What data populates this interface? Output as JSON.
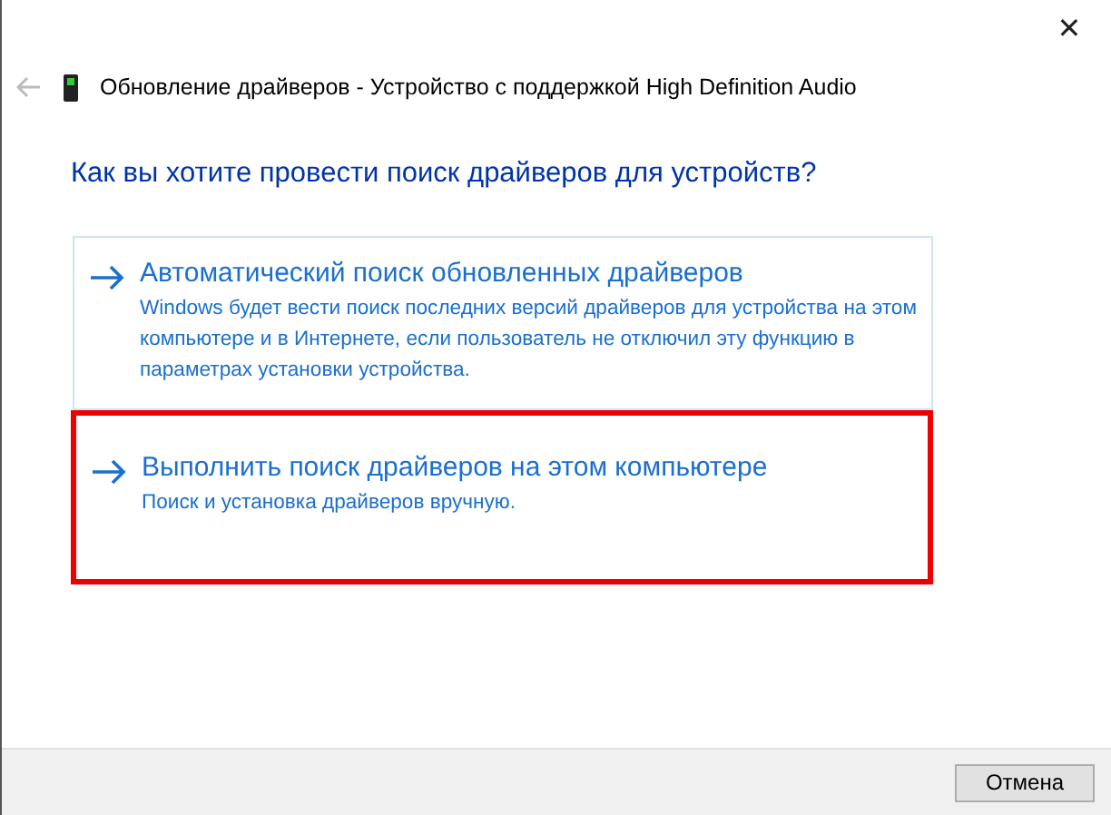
{
  "window": {
    "title": "Обновление драйверов - Устройство с поддержкой High Definition Audio",
    "close": "✕"
  },
  "heading": "Как вы хотите провести поиск драйверов для устройств?",
  "options": [
    {
      "title": "Автоматический поиск обновленных драйверов",
      "description": "Windows будет вести поиск последних версий драйверов для устройства на этом компьютере и в Интернете, если пользователь не отключил эту функцию в параметрах установки устройства.",
      "hovered": true,
      "highlighted": false
    },
    {
      "title": "Выполнить поиск драйверов на этом компьютере",
      "description": "Поиск и установка драйверов вручную.",
      "hovered": false,
      "highlighted": true
    }
  ],
  "buttons": [
    "Отмена"
  ]
}
